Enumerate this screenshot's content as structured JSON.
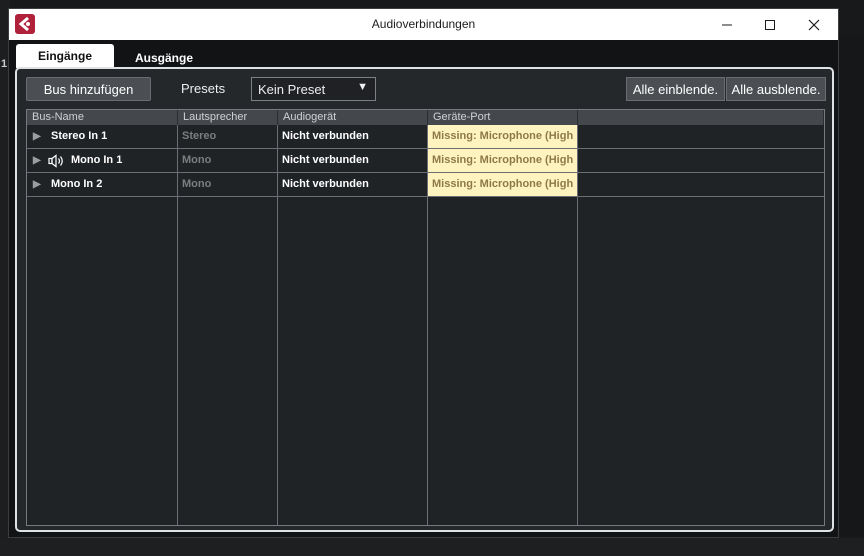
{
  "background": {
    "left_number": "1!"
  },
  "window": {
    "title": "Audioverbindungen",
    "controls": {
      "minimize": "—",
      "maximize": "☐",
      "close": "✕"
    },
    "colors": {
      "titlebar": "#ffffff",
      "accent_logo": "#b0213a"
    }
  },
  "tabs": [
    {
      "label": "Eingänge",
      "active": true
    },
    {
      "label": "Ausgänge",
      "active": false
    }
  ],
  "toolbar": {
    "add_bus": "Bus hinzufügen",
    "presets_label": "Presets",
    "preset_value": "Kein Preset",
    "preset_arrow": "▼",
    "show_all": "Alle einblende.",
    "hide_all": "Alle ausblende."
  },
  "table": {
    "headers": [
      "Bus-Name",
      "Lautsprecher",
      "Audiogerät",
      "Geräte-Port",
      ""
    ],
    "rows": [
      {
        "expand": "▶",
        "name": "Stereo In 1",
        "speaker": "Stereo",
        "device": "Nicht verbunden",
        "port": "Missing: Microphone (High",
        "icon": ""
      },
      {
        "expand": "▶",
        "name": "Mono In 1",
        "speaker": "Mono",
        "device": "Nicht verbunden",
        "port": "Missing: Microphone (High",
        "icon": "speaker-icon"
      },
      {
        "expand": "▶",
        "name": "Mono In 2",
        "speaker": "Mono",
        "device": "Nicht verbunden",
        "port": "Missing: Microphone (High",
        "icon": ""
      }
    ]
  }
}
